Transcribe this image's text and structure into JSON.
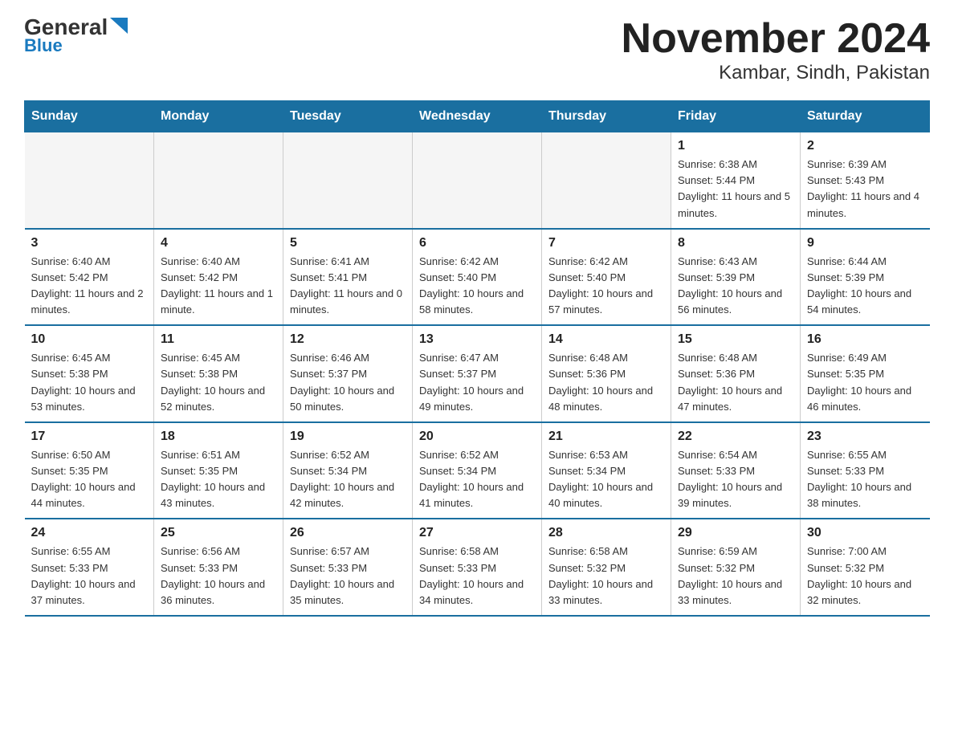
{
  "logo": {
    "part1": "General",
    "part2": "Blue"
  },
  "title": "November 2024",
  "subtitle": "Kambar, Sindh, Pakistan",
  "weekdays": [
    "Sunday",
    "Monday",
    "Tuesday",
    "Wednesday",
    "Thursday",
    "Friday",
    "Saturday"
  ],
  "weeks": [
    [
      {
        "day": "",
        "info": ""
      },
      {
        "day": "",
        "info": ""
      },
      {
        "day": "",
        "info": ""
      },
      {
        "day": "",
        "info": ""
      },
      {
        "day": "",
        "info": ""
      },
      {
        "day": "1",
        "info": "Sunrise: 6:38 AM\nSunset: 5:44 PM\nDaylight: 11 hours and 5 minutes."
      },
      {
        "day": "2",
        "info": "Sunrise: 6:39 AM\nSunset: 5:43 PM\nDaylight: 11 hours and 4 minutes."
      }
    ],
    [
      {
        "day": "3",
        "info": "Sunrise: 6:40 AM\nSunset: 5:42 PM\nDaylight: 11 hours and 2 minutes."
      },
      {
        "day": "4",
        "info": "Sunrise: 6:40 AM\nSunset: 5:42 PM\nDaylight: 11 hours and 1 minute."
      },
      {
        "day": "5",
        "info": "Sunrise: 6:41 AM\nSunset: 5:41 PM\nDaylight: 11 hours and 0 minutes."
      },
      {
        "day": "6",
        "info": "Sunrise: 6:42 AM\nSunset: 5:40 PM\nDaylight: 10 hours and 58 minutes."
      },
      {
        "day": "7",
        "info": "Sunrise: 6:42 AM\nSunset: 5:40 PM\nDaylight: 10 hours and 57 minutes."
      },
      {
        "day": "8",
        "info": "Sunrise: 6:43 AM\nSunset: 5:39 PM\nDaylight: 10 hours and 56 minutes."
      },
      {
        "day": "9",
        "info": "Sunrise: 6:44 AM\nSunset: 5:39 PM\nDaylight: 10 hours and 54 minutes."
      }
    ],
    [
      {
        "day": "10",
        "info": "Sunrise: 6:45 AM\nSunset: 5:38 PM\nDaylight: 10 hours and 53 minutes."
      },
      {
        "day": "11",
        "info": "Sunrise: 6:45 AM\nSunset: 5:38 PM\nDaylight: 10 hours and 52 minutes."
      },
      {
        "day": "12",
        "info": "Sunrise: 6:46 AM\nSunset: 5:37 PM\nDaylight: 10 hours and 50 minutes."
      },
      {
        "day": "13",
        "info": "Sunrise: 6:47 AM\nSunset: 5:37 PM\nDaylight: 10 hours and 49 minutes."
      },
      {
        "day": "14",
        "info": "Sunrise: 6:48 AM\nSunset: 5:36 PM\nDaylight: 10 hours and 48 minutes."
      },
      {
        "day": "15",
        "info": "Sunrise: 6:48 AM\nSunset: 5:36 PM\nDaylight: 10 hours and 47 minutes."
      },
      {
        "day": "16",
        "info": "Sunrise: 6:49 AM\nSunset: 5:35 PM\nDaylight: 10 hours and 46 minutes."
      }
    ],
    [
      {
        "day": "17",
        "info": "Sunrise: 6:50 AM\nSunset: 5:35 PM\nDaylight: 10 hours and 44 minutes."
      },
      {
        "day": "18",
        "info": "Sunrise: 6:51 AM\nSunset: 5:35 PM\nDaylight: 10 hours and 43 minutes."
      },
      {
        "day": "19",
        "info": "Sunrise: 6:52 AM\nSunset: 5:34 PM\nDaylight: 10 hours and 42 minutes."
      },
      {
        "day": "20",
        "info": "Sunrise: 6:52 AM\nSunset: 5:34 PM\nDaylight: 10 hours and 41 minutes."
      },
      {
        "day": "21",
        "info": "Sunrise: 6:53 AM\nSunset: 5:34 PM\nDaylight: 10 hours and 40 minutes."
      },
      {
        "day": "22",
        "info": "Sunrise: 6:54 AM\nSunset: 5:33 PM\nDaylight: 10 hours and 39 minutes."
      },
      {
        "day": "23",
        "info": "Sunrise: 6:55 AM\nSunset: 5:33 PM\nDaylight: 10 hours and 38 minutes."
      }
    ],
    [
      {
        "day": "24",
        "info": "Sunrise: 6:55 AM\nSunset: 5:33 PM\nDaylight: 10 hours and 37 minutes."
      },
      {
        "day": "25",
        "info": "Sunrise: 6:56 AM\nSunset: 5:33 PM\nDaylight: 10 hours and 36 minutes."
      },
      {
        "day": "26",
        "info": "Sunrise: 6:57 AM\nSunset: 5:33 PM\nDaylight: 10 hours and 35 minutes."
      },
      {
        "day": "27",
        "info": "Sunrise: 6:58 AM\nSunset: 5:33 PM\nDaylight: 10 hours and 34 minutes."
      },
      {
        "day": "28",
        "info": "Sunrise: 6:58 AM\nSunset: 5:32 PM\nDaylight: 10 hours and 33 minutes."
      },
      {
        "day": "29",
        "info": "Sunrise: 6:59 AM\nSunset: 5:32 PM\nDaylight: 10 hours and 33 minutes."
      },
      {
        "day": "30",
        "info": "Sunrise: 7:00 AM\nSunset: 5:32 PM\nDaylight: 10 hours and 32 minutes."
      }
    ]
  ]
}
